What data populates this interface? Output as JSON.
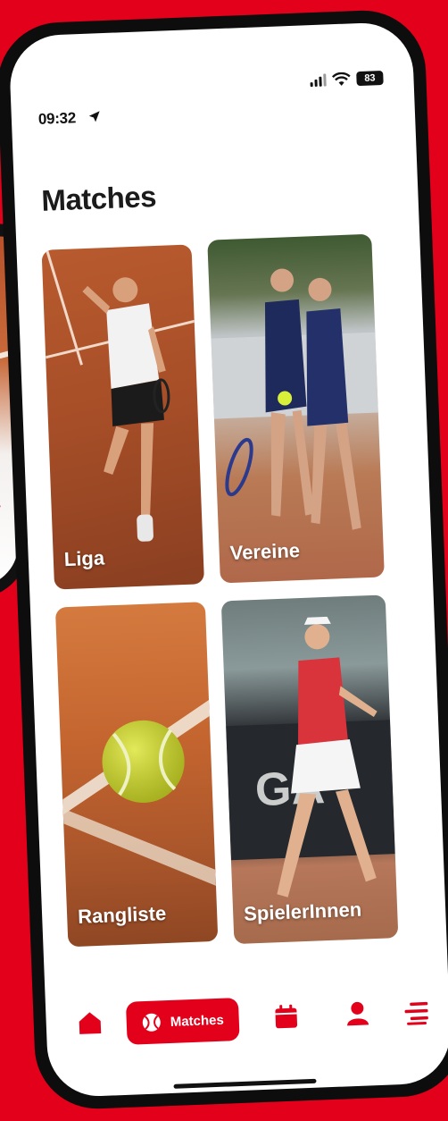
{
  "status_bar": {
    "time": "09:32",
    "battery": "83"
  },
  "page": {
    "title": "Matches"
  },
  "tiles": [
    {
      "label": "Liga"
    },
    {
      "label": "Vereine"
    },
    {
      "label": "Rangliste"
    },
    {
      "label": "SpielerInnen"
    }
  ],
  "tabbar": {
    "items": [
      {
        "icon": "home-icon"
      },
      {
        "icon": "tennis-ball-icon",
        "label": "Matches",
        "active": true
      },
      {
        "icon": "calendar-icon"
      },
      {
        "icon": "user-icon"
      },
      {
        "icon": "menu-icon"
      }
    ]
  },
  "colors": {
    "brand": "#e3001b",
    "background": "#ffffff",
    "text": "#1b1b1b"
  }
}
